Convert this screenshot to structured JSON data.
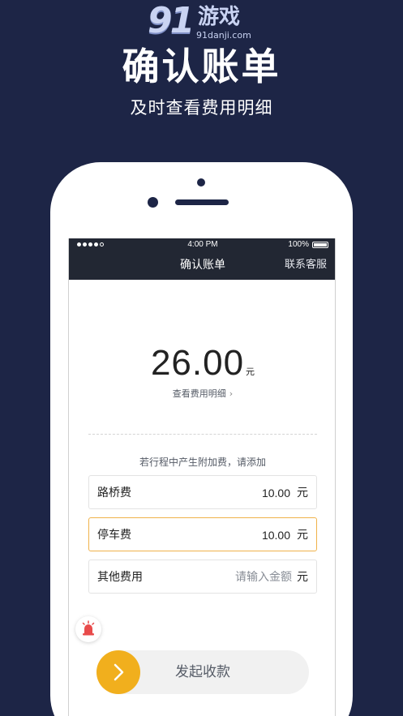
{
  "logo": {
    "mark": "91",
    "name": "游戏",
    "url": "91danji.com"
  },
  "promo": {
    "headline": "确认账单",
    "subline": "及时查看费用明细"
  },
  "status_bar": {
    "time": "4:00 PM",
    "battery": "100%",
    "signal_bars": 4
  },
  "nav": {
    "title": "确认账单",
    "right_action": "联系客服"
  },
  "bill": {
    "amount": "26.00",
    "unit": "元",
    "detail_link": "查看费用明细"
  },
  "extra_fees": {
    "hint": "若行程中产生附加费，请添加",
    "items": [
      {
        "label": "路桥费",
        "value": "10.00",
        "unit": "元"
      },
      {
        "label": "停车费",
        "value": "10.00",
        "unit": "元"
      },
      {
        "label": "其他费用",
        "placeholder": "请输入金额",
        "unit": "元"
      }
    ]
  },
  "action": {
    "slider_label": "发起收款"
  },
  "colors": {
    "background": "#1d2546",
    "accent": "#f1af1d",
    "navbar": "#222733",
    "alarm": "#e84b4b"
  }
}
